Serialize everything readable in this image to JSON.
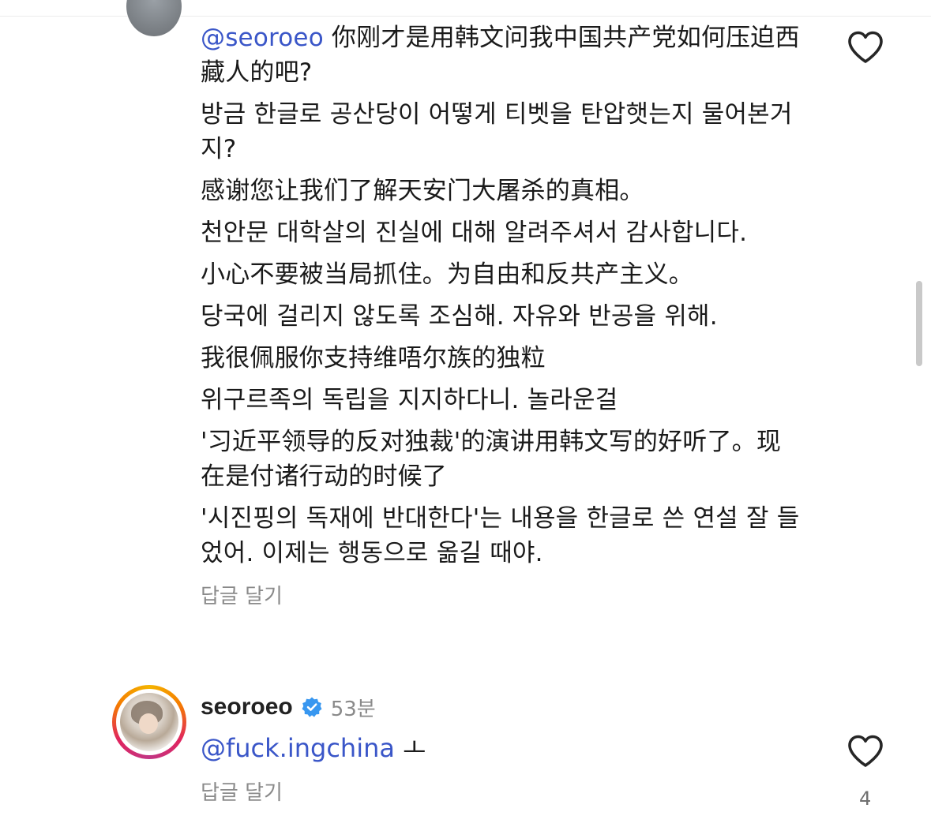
{
  "comment1": {
    "mention": "@seoroeo",
    "first_text": " 你刚才是用韩文问我中国共产党如何压迫西藏人的吧?",
    "paragraphs": [
      "방금 한글로 공산당이 어떻게 티벳을 탄압햇는지 물어본거지?",
      "感谢您让我们了解天安门大屠杀的真相。",
      "천안문 대학살의 진실에 대해 알려주셔서 감사합니다.",
      "小心不要被当局抓住。为自由和反共产主义。",
      "당국에 걸리지 않도록 조심해. 자유와 반공을 위해.",
      "我很佩服你支持维唔尔族的独粒",
      "위구르족의 독립을 지지하다니. 놀라운걸",
      "'习近平领导的反对独裁'的演讲用韩文写的好听了。现在是付诸行动的时候了",
      "'시진핑의 독재에 반대한다'는 내용을 한글로 쓴 연설 잘 들었어. 이제는 행동으로 옮길 때야."
    ],
    "reply_label": "답글 달기",
    "like_icon": "heart-outline-icon"
  },
  "comment2": {
    "username": "seoroeo",
    "verified_icon": "verified-badge-icon",
    "time": "53분",
    "mention": "@fuck.ingchina",
    "text": " ㅗ",
    "reply_label": "답글 달기",
    "like_icon": "heart-outline-icon",
    "like_count": "4"
  },
  "colors": {
    "mention": "#3a56c8",
    "verified": "#3897f0",
    "secondary_text": "#8a8a8a"
  }
}
